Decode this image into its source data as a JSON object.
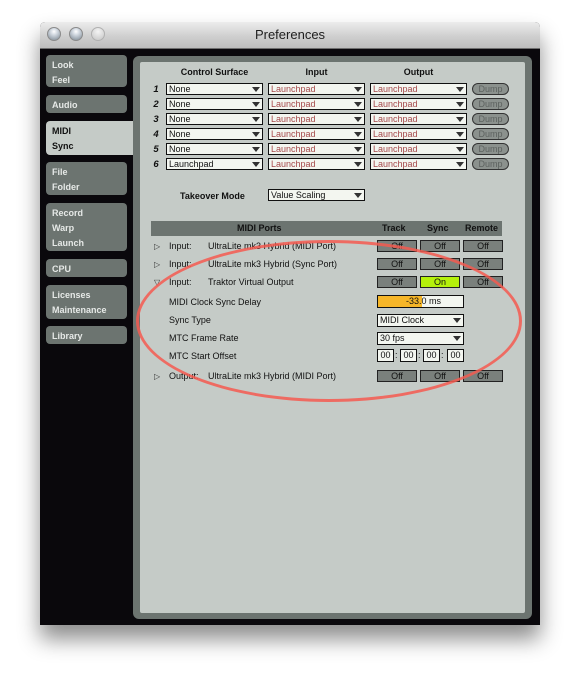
{
  "window": {
    "title": "Preferences",
    "traffic_lights": [
      "close",
      "minimize",
      "zoom"
    ]
  },
  "sidebar": {
    "tabs": [
      {
        "lines": [
          "Look",
          "Feel"
        ],
        "active": false
      },
      {
        "lines": [
          "Audio"
        ],
        "active": false
      },
      {
        "lines": [
          "MIDI",
          "Sync"
        ],
        "active": true
      },
      {
        "lines": [
          "File",
          "Folder"
        ],
        "active": false
      },
      {
        "lines": [
          "Record",
          "Warp",
          "Launch"
        ],
        "active": false
      },
      {
        "lines": [
          "CPU"
        ],
        "active": false
      },
      {
        "lines": [
          "Licenses",
          "Maintenance"
        ],
        "active": false
      },
      {
        "lines": [
          "Library"
        ],
        "active": false
      }
    ]
  },
  "control_surfaces": {
    "headers": {
      "surface": "Control Surface",
      "input": "Input",
      "output": "Output"
    },
    "rows": [
      {
        "num": "1",
        "surface": "None",
        "input": "Launchpad",
        "output": "Launchpad",
        "dump": "Dump"
      },
      {
        "num": "2",
        "surface": "None",
        "input": "Launchpad",
        "output": "Launchpad",
        "dump": "Dump"
      },
      {
        "num": "3",
        "surface": "None",
        "input": "Launchpad",
        "output": "Launchpad",
        "dump": "Dump"
      },
      {
        "num": "4",
        "surface": "None",
        "input": "Launchpad",
        "output": "Launchpad",
        "dump": "Dump"
      },
      {
        "num": "5",
        "surface": "None",
        "input": "Launchpad",
        "output": "Launchpad",
        "dump": "Dump"
      },
      {
        "num": "6",
        "surface": "Launchpad",
        "input": "Launchpad",
        "output": "Launchpad",
        "dump": "Dump"
      }
    ]
  },
  "takeover": {
    "label": "Takeover Mode",
    "value": "Value Scaling"
  },
  "midi_ports": {
    "headers": {
      "ports": "MIDI Ports",
      "track": "Track",
      "sync": "Sync",
      "remote": "Remote"
    },
    "ports": [
      {
        "direction": "Input:",
        "name": "UltraLite mk3 Hybrid (MIDI Port)",
        "expanded": false,
        "track": "Off",
        "sync": "Off",
        "remote": "Off"
      },
      {
        "direction": "Input:",
        "name": "UltraLite mk3 Hybrid (Sync Port)",
        "expanded": false,
        "track": "Off",
        "sync": "Off",
        "remote": "Off"
      },
      {
        "direction": "Input:",
        "name": "Traktor Virtual Output",
        "expanded": true,
        "track": "Off",
        "sync": "On",
        "remote": "Off"
      },
      {
        "direction": "Output:",
        "name": "UltraLite mk3 Hybrid (MIDI Port)",
        "expanded": false,
        "track": "Off",
        "sync": "Off",
        "remote": "Off"
      }
    ],
    "sync_settings": {
      "clock_delay": {
        "label": "MIDI Clock Sync Delay",
        "value": "-33.0 ms",
        "fill_fraction": 0.52
      },
      "sync_type": {
        "label": "Sync Type",
        "value": "MIDI Clock"
      },
      "frame_rate": {
        "label": "MTC Frame Rate",
        "value": "30 fps"
      },
      "start_offset": {
        "label": "MTC Start Offset",
        "values": [
          "00",
          "00",
          "00",
          "00"
        ],
        "separator": ":"
      }
    }
  },
  "colors": {
    "accent_on": "#b5f10c",
    "delay_fill": "#f6b628",
    "annotation": "#f55a50",
    "panel_bg": "#c5cbc7",
    "frame": "#6c7470"
  }
}
